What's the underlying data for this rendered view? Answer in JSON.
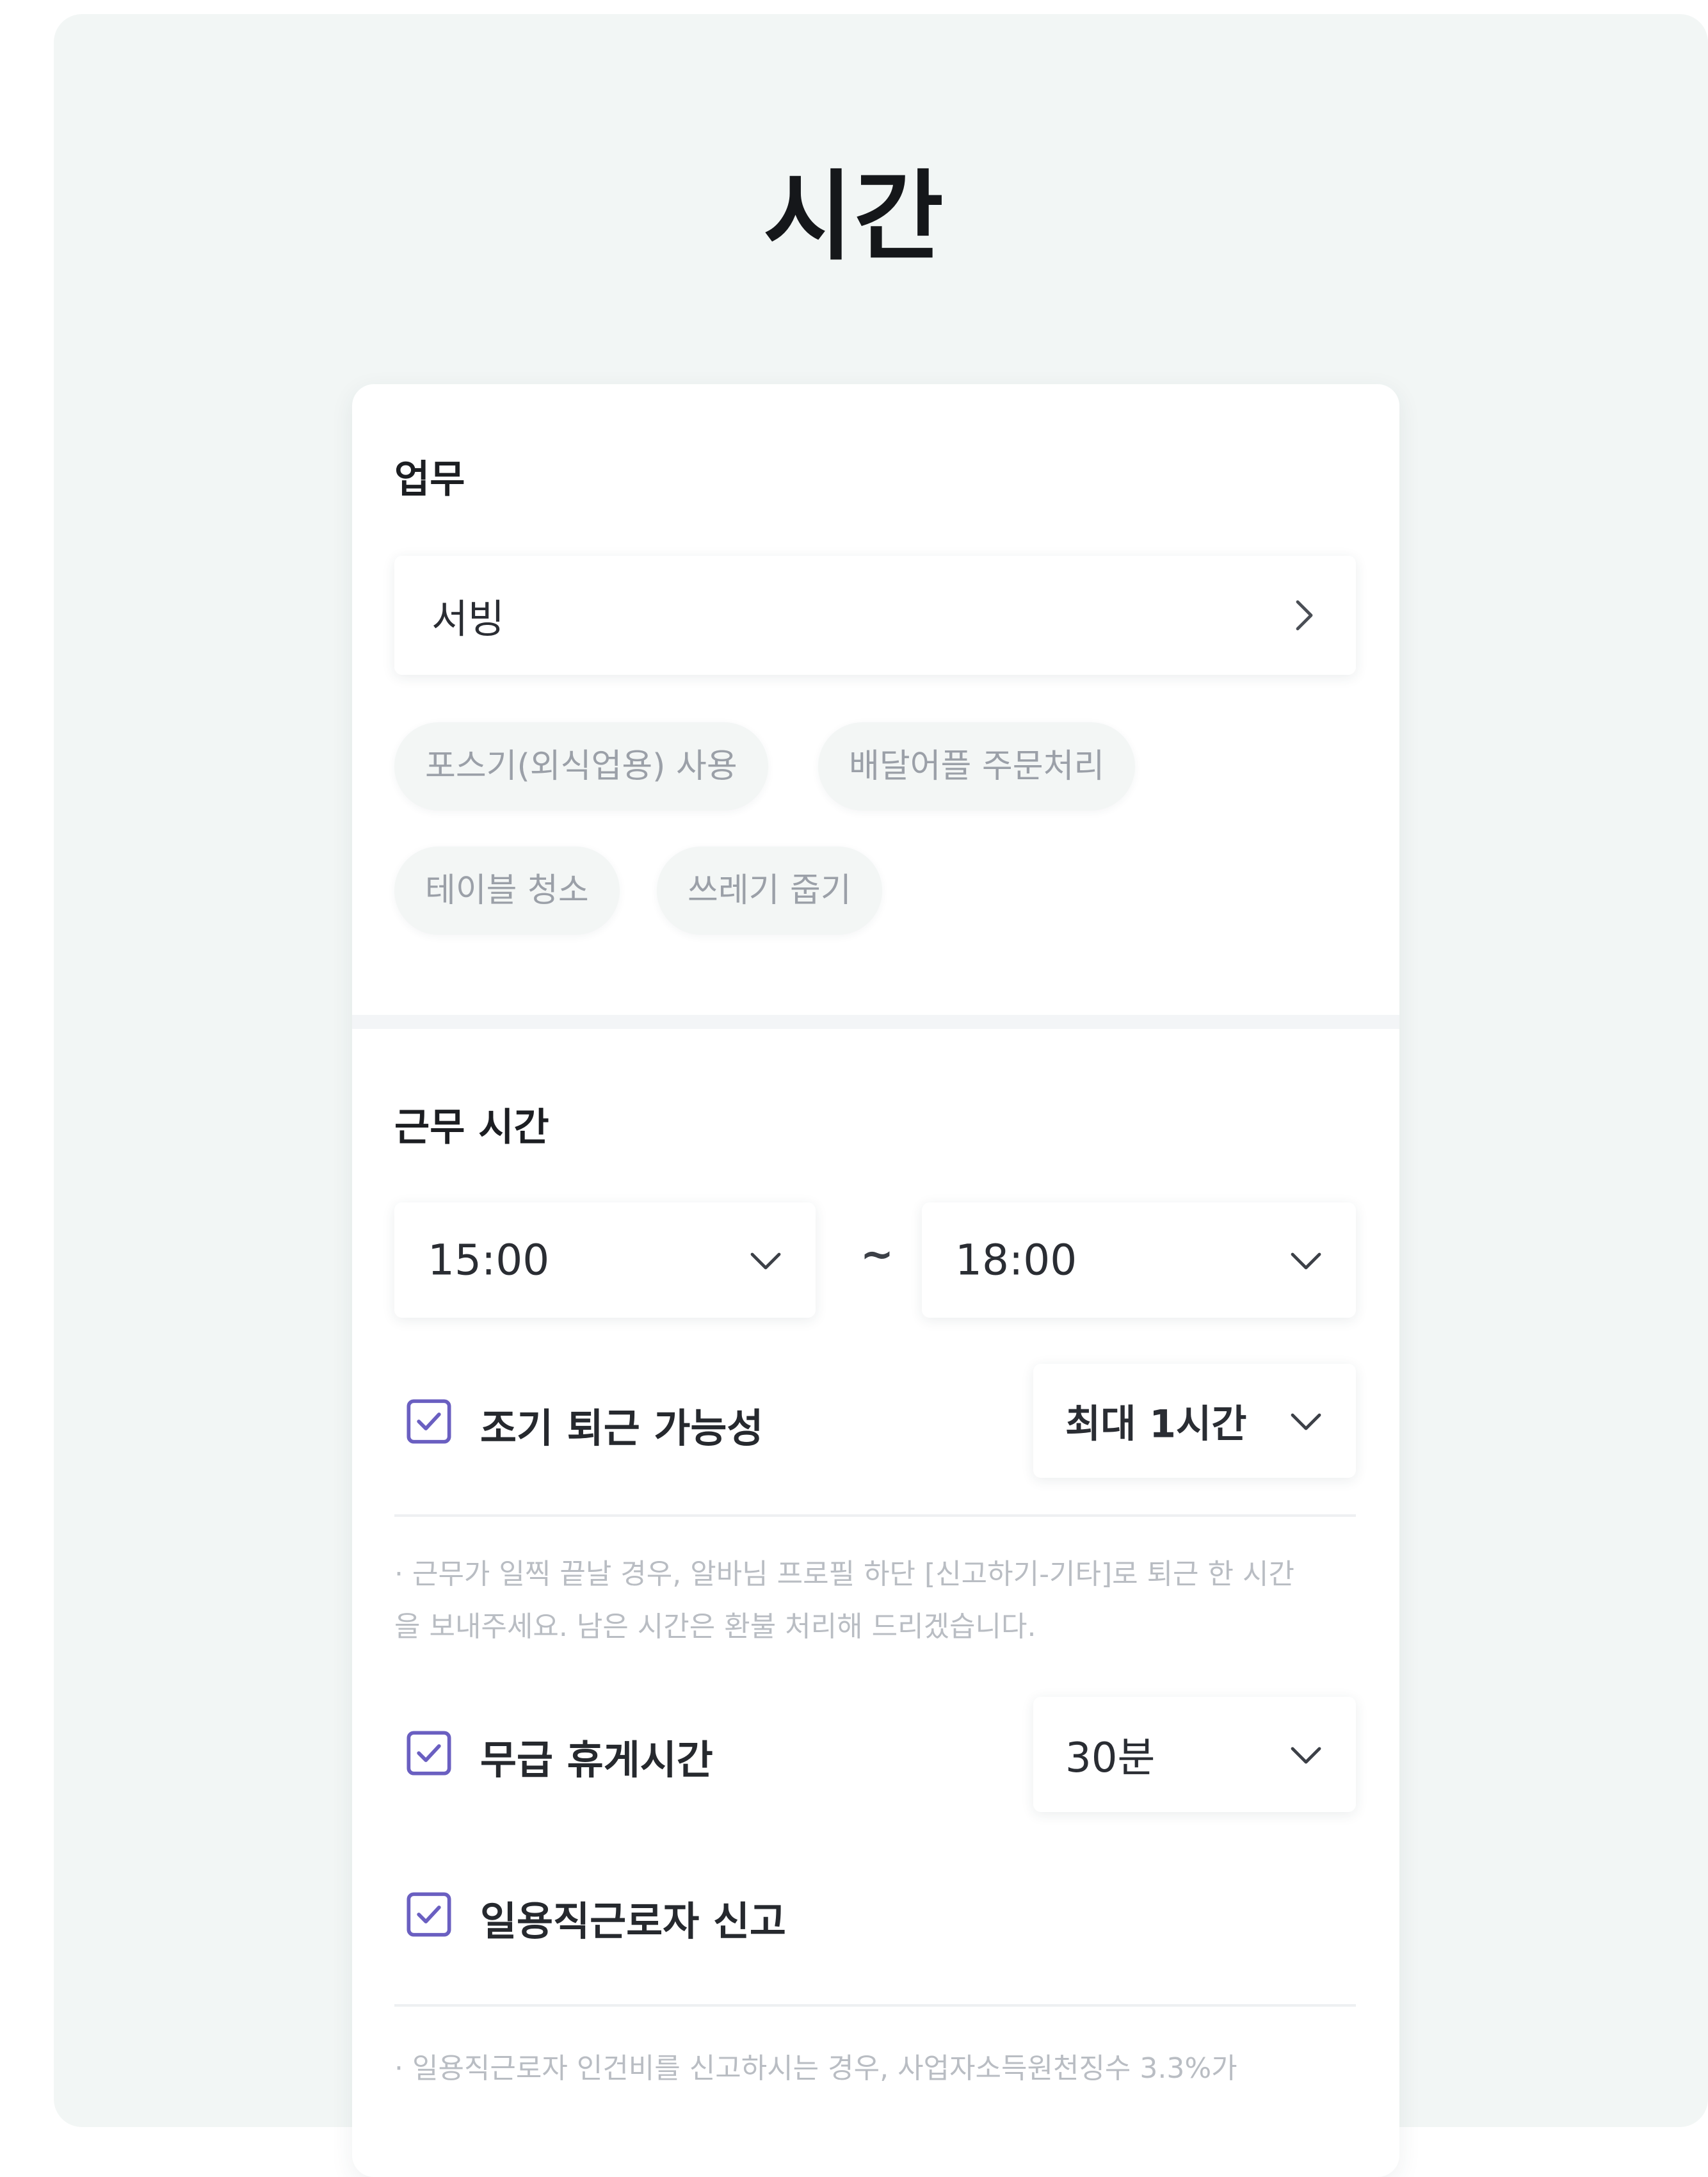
{
  "page": {
    "title": "시간"
  },
  "work": {
    "section_label": "업무",
    "selected_task": "서빙",
    "chips": [
      "포스기(외식업용) 사용",
      "배달어플 주문처리",
      "테이블 청소",
      "쓰레기 줍기"
    ]
  },
  "work_time": {
    "section_label": "근무 시간",
    "start": "15:00",
    "separator": "~",
    "end": "18:00",
    "early_leave": {
      "checked": true,
      "label": "조기 퇴근 가능성",
      "option": "최대 1시간"
    },
    "early_leave_note": "· 근무가 일찍 끝날 경우, 알바님 프로필 하단 [신고하기-기타]로 퇴근 한 시간을 보내주세요. 남은 시간은 환불 처리해 드리겠습니다.",
    "unpaid_break": {
      "checked": true,
      "label": "무급 휴게시간",
      "option": "30분"
    },
    "daily_worker_report": {
      "checked": true,
      "label": "일용직근로자 신고"
    },
    "daily_worker_note": "· 일용직근로자 인건비를 신고하시는 경우, 사업자소득원천징수 3.3%가"
  },
  "colors": {
    "background": "#f2f6f5",
    "card": "#ffffff",
    "checkbox_accent": "#6a5fc1",
    "title_text": "#15171a",
    "muted_text": "#9ba0a8"
  },
  "icons": {
    "task_chevron": "chevron-right-icon",
    "dropdown_chevron": "chevron-down-icon",
    "checkbox": "checkbox-checked-icon"
  }
}
